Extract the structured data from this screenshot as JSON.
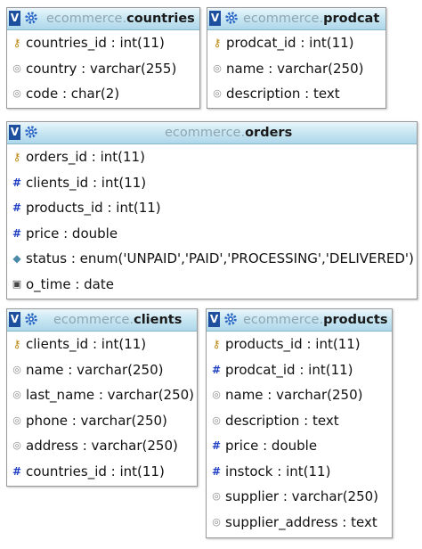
{
  "tables": {
    "countries": {
      "db": "ecommerce.",
      "name": "countries",
      "columns": [
        {
          "text": "countries_id : int(11)",
          "icon": "key-icon"
        },
        {
          "text": "country : varchar(255)",
          "icon": "text-field-icon"
        },
        {
          "text": "code : char(2)",
          "icon": "text-field-icon"
        }
      ]
    },
    "prodcat": {
      "db": "ecommerce.",
      "name": "prodcat",
      "columns": [
        {
          "text": "prodcat_id : int(11)",
          "icon": "key-icon"
        },
        {
          "text": "name : varchar(250)",
          "icon": "text-field-icon"
        },
        {
          "text": "description : text",
          "icon": "text-field-icon"
        }
      ]
    },
    "orders": {
      "db": "ecommerce.",
      "name": "orders",
      "columns": [
        {
          "text": "orders_id : int(11)",
          "icon": "key-icon"
        },
        {
          "text": "clients_id : int(11)",
          "icon": "numeric-field-icon"
        },
        {
          "text": "products_id : int(11)",
          "icon": "numeric-field-icon"
        },
        {
          "text": "price : double",
          "icon": "numeric-field-icon"
        },
        {
          "text": "status : enum('UNPAID','PAID','PROCESSING','DELIVERED')",
          "icon": "enum-field-icon"
        },
        {
          "text": "o_time : date",
          "icon": "date-field-icon"
        }
      ]
    },
    "clients": {
      "db": "ecommerce.",
      "name": "clients",
      "columns": [
        {
          "text": "clients_id : int(11)",
          "icon": "key-icon"
        },
        {
          "text": "name : varchar(250)",
          "icon": "text-field-icon"
        },
        {
          "text": "last_name : varchar(250)",
          "icon": "text-field-icon"
        },
        {
          "text": "phone : varchar(250)",
          "icon": "text-field-icon"
        },
        {
          "text": "address : varchar(250)",
          "icon": "text-field-icon"
        },
        {
          "text": "countries_id : int(11)",
          "icon": "numeric-field-icon"
        }
      ]
    },
    "products": {
      "db": "ecommerce.",
      "name": "products",
      "columns": [
        {
          "text": "products_id : int(11)",
          "icon": "key-icon"
        },
        {
          "text": "prodcat_id : int(11)",
          "icon": "numeric-field-icon"
        },
        {
          "text": "name : varchar(250)",
          "icon": "text-field-icon"
        },
        {
          "text": "description : text",
          "icon": "text-field-icon"
        },
        {
          "text": "price : double",
          "icon": "numeric-field-icon"
        },
        {
          "text": "instock : int(11)",
          "icon": "numeric-field-icon"
        },
        {
          "text": "supplier : varchar(250)",
          "icon": "text-field-icon"
        },
        {
          "text": "supplier_address : text",
          "icon": "text-field-icon"
        }
      ]
    }
  },
  "toggle_button_label": "V",
  "colors": {
    "header_gradient_top": "#eaf6fb",
    "header_gradient_bottom": "#aed7ea",
    "toggle_button": "#1d4f9e",
    "db_prefix": "#8fa5b3",
    "key_icon": "#b8860b",
    "numeric_icon": "#1f3fc4"
  }
}
